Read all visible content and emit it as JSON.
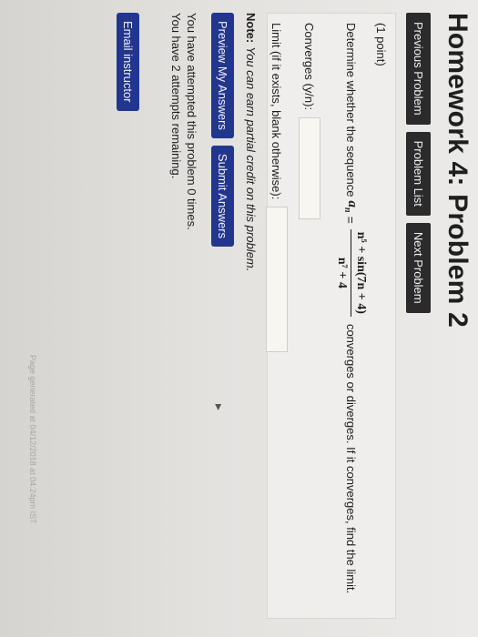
{
  "page": {
    "title": "Homework 4: Problem 2"
  },
  "nav": {
    "previous": "Previous Problem",
    "list": "Problem List",
    "next": "Next Problem"
  },
  "problem": {
    "points": "(1 point)",
    "prompt_start": "Determine whether the sequence",
    "sequence_symbol": "a",
    "sequence_subscript": "n",
    "equals": "=",
    "numerator": "n⁵ + sin(7n + 4)",
    "denominator": "n⁷ + 4",
    "prompt_end": "converges or diverges. If it converges, find the limit.",
    "converges_label": "Converges (y/n):",
    "converges_value": "",
    "limit_label": "Limit (if it exists, blank otherwise):",
    "limit_value": ""
  },
  "note": {
    "label": "Note:",
    "text": "You can earn partial credit on this problem."
  },
  "actions": {
    "preview": "Preview My Answers",
    "submit": "Submit Answers"
  },
  "attempts": {
    "attempted": "You have attempted this problem 0 times.",
    "remaining": "You have 2 attempts remaining."
  },
  "email": {
    "label": "Email instructor"
  },
  "footer": {
    "text": "Page generated at 04/12/2018 at 04:24pm IST"
  },
  "colors": {
    "nav_button": "#2b2b2b",
    "action_button": "#22368f",
    "background": "#e7e6e3"
  }
}
